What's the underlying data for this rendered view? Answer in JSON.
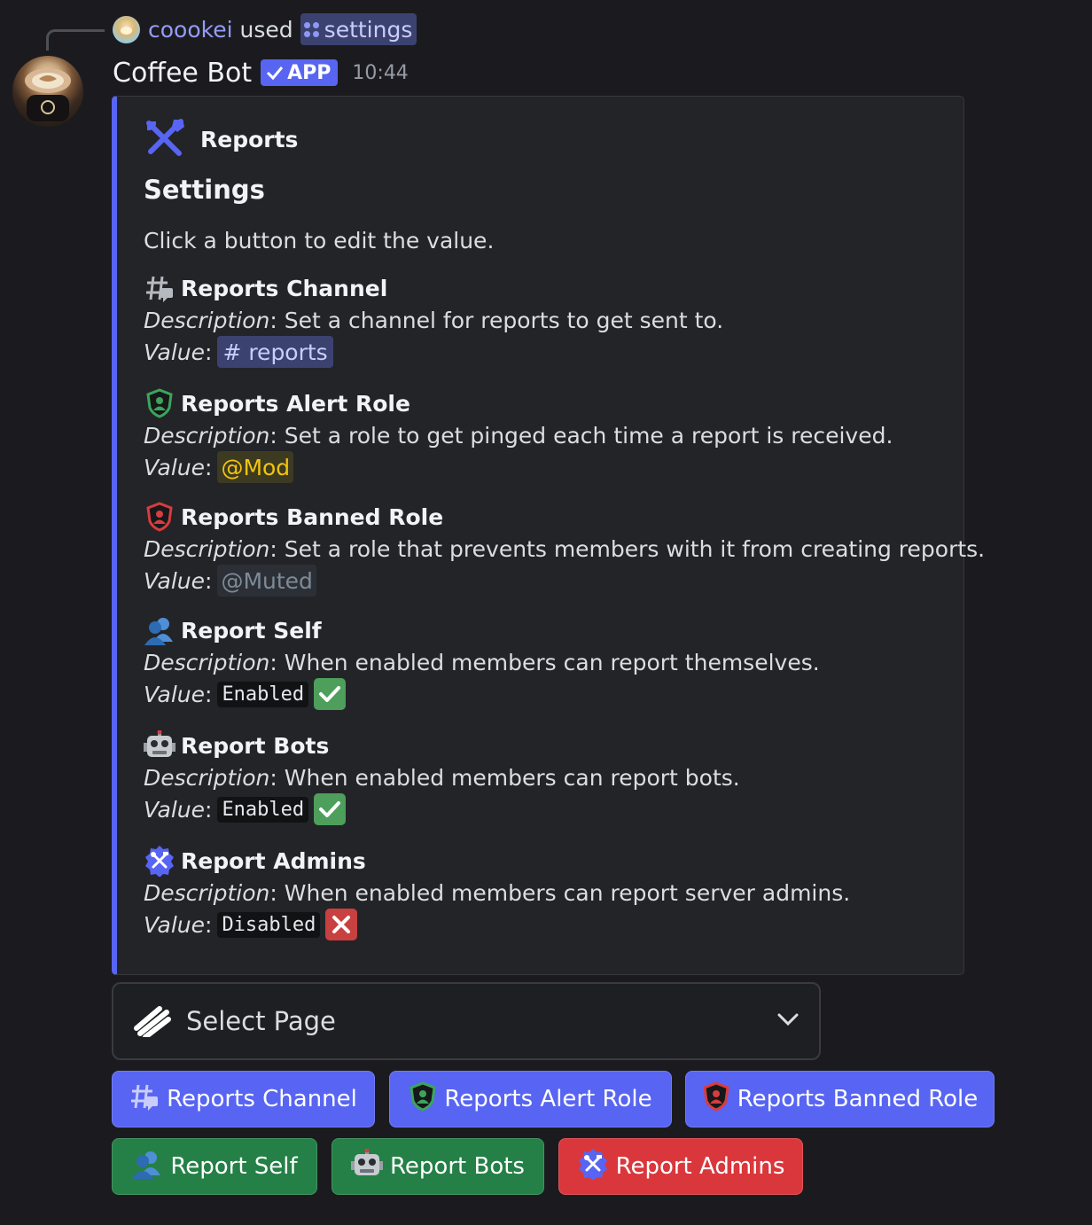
{
  "reply": {
    "user": "coookei",
    "verb": "used",
    "command": "settings"
  },
  "message": {
    "bot_name": "Coffee Bot",
    "badge": "APP",
    "time": "10:44"
  },
  "embed": {
    "accent_color": "#5865f2",
    "author": "Reports",
    "author_icon": "hammer-wrench-icon",
    "title": "Settings",
    "description": "Click a button to edit the value.",
    "description_label": "Description",
    "value_label": "Value",
    "fields": [
      {
        "name": "Reports Channel",
        "icon": "channel-hash-icon",
        "description": "Set a channel for reports to get sent to.",
        "value": "# reports"
      },
      {
        "name": "Reports Alert Role",
        "icon": "green-shield-user-icon",
        "description": "Set a role to get pinged each time a report is received.",
        "value": "@Mod"
      },
      {
        "name": "Reports Banned Role",
        "icon": "red-shield-user-icon",
        "description": "Set a role that prevents members with it from creating reports.",
        "value": "@Muted"
      },
      {
        "name": "Report Self",
        "icon": "members-icon",
        "description": "When enabled members can report themselves.",
        "value": "Enabled",
        "status": "check"
      },
      {
        "name": "Report Bots",
        "icon": "robot-icon",
        "description": "When enabled members can report bots.",
        "value": "Enabled",
        "status": "check"
      },
      {
        "name": "Report Admins",
        "icon": "admin-tools-icon",
        "description": "When enabled members can report server admins.",
        "value": "Disabled",
        "status": "cross"
      }
    ]
  },
  "select": {
    "placeholder": "Select Page"
  },
  "buttons": [
    {
      "label": "Reports Channel",
      "style": "blurple"
    },
    {
      "label": "Reports Alert Role",
      "style": "blurple"
    },
    {
      "label": "Reports Banned Role",
      "style": "blurple"
    },
    {
      "label": "Report Self",
      "style": "green"
    },
    {
      "label": "Report Bots",
      "style": "green"
    },
    {
      "label": "Report Admins",
      "style": "red"
    }
  ]
}
